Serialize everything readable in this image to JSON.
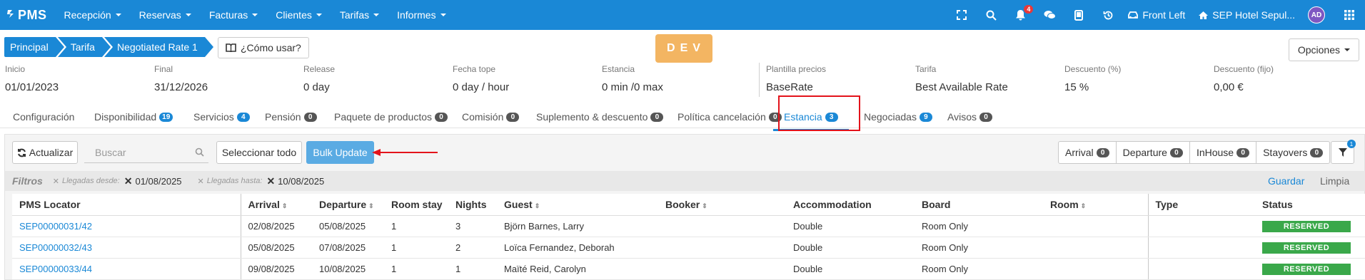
{
  "brand": {
    "name": "PMS",
    "icon": "logo-icon"
  },
  "nav": [
    {
      "label": "Recepción"
    },
    {
      "label": "Reservas"
    },
    {
      "label": "Facturas"
    },
    {
      "label": "Clientes"
    },
    {
      "label": "Tarifas"
    },
    {
      "label": "Informes"
    }
  ],
  "topbar": {
    "notifications_count": "4",
    "front_label": "Front Left",
    "hotel_label": "SEP Hotel Sepul...",
    "avatar_initials": "AD"
  },
  "breadcrumb": [
    "Principal",
    "Tarifa",
    "Negotiated Rate 1"
  ],
  "howto_label": "¿Cómo usar?",
  "env_badge": "DEV",
  "options_label": "Opciones",
  "info": [
    {
      "label": "Inicio",
      "value": "01/01/2023"
    },
    {
      "label": "Final",
      "value": "31/12/2026"
    },
    {
      "label": "Release",
      "value": "0 day"
    },
    {
      "label": "Fecha tope",
      "value": "0 day / hour"
    },
    {
      "label": "Estancia",
      "value": "0 min /0 max"
    },
    {
      "label": "Plantilla precios",
      "value": "BaseRate"
    },
    {
      "label": "Tarifa",
      "value": "Best Available Rate"
    },
    {
      "label": "Descuento (%)",
      "value": "15 %"
    },
    {
      "label": "Descuento (fijo)",
      "value": "0,00 €"
    }
  ],
  "tabs": [
    {
      "label": "Configuración",
      "badge": ""
    },
    {
      "label": "Disponibilidad",
      "badge": "19"
    },
    {
      "label": "Servicios",
      "badge": "4"
    },
    {
      "label": "Pensión",
      "badge": "0"
    },
    {
      "label": "Paquete de productos",
      "badge": "0"
    },
    {
      "label": "Comisión",
      "badge": "0"
    },
    {
      "label": "Suplemento & descuento",
      "badge": "0"
    },
    {
      "label": "Política cancelación",
      "badge": "0"
    },
    {
      "label": "Estancia",
      "badge": "3"
    },
    {
      "label": "Negociadas",
      "badge": "9"
    },
    {
      "label": "Avisos",
      "badge": "0"
    }
  ],
  "toolbar": {
    "refresh_label": "Actualizar",
    "search_placeholder": "Buscar",
    "select_all_label": "Seleccionar todo",
    "bulk_update_label": "Bulk Update",
    "segments": [
      {
        "label": "Arrival",
        "count": "0"
      },
      {
        "label": "Departure",
        "count": "0"
      },
      {
        "label": "InHouse",
        "count": "0"
      },
      {
        "label": "Stayovers",
        "count": "0"
      }
    ],
    "filter_badge": "1"
  },
  "filters": {
    "title": "Filtros",
    "from_label": "Llegadas desde:",
    "from_value": "01/08/2025",
    "to_label": "Llegadas hasta:",
    "to_value": "10/08/2025",
    "save_label": "Guardar",
    "clear_label": "Limpia"
  },
  "table": {
    "columns": [
      "PMS Locator",
      "Arrival",
      "Departure",
      "Room stay",
      "Nights",
      "Guest",
      "Booker",
      "Accommodation",
      "Board",
      "Room",
      "Type",
      "Status"
    ],
    "rows": [
      {
        "locator": "SEP00000031/42",
        "arrival": "02/08/2025",
        "departure": "05/08/2025",
        "room_stay": "1",
        "nights": "3",
        "guest": "Björn Barnes, Larry",
        "booker": "",
        "accommodation": "Double",
        "board": "Room Only",
        "room": "",
        "type": "",
        "status": "RESERVED"
      },
      {
        "locator": "SEP00000032/43",
        "arrival": "05/08/2025",
        "departure": "07/08/2025",
        "room_stay": "1",
        "nights": "2",
        "guest": "Loïca Fernandez, Deborah",
        "booker": "",
        "accommodation": "Double",
        "board": "Room Only",
        "room": "",
        "type": "",
        "status": "RESERVED"
      },
      {
        "locator": "SEP00000033/44",
        "arrival": "09/08/2025",
        "departure": "10/08/2025",
        "room_stay": "1",
        "nights": "1",
        "guest": "Maïté Reid, Carolyn",
        "booker": "",
        "accommodation": "Double",
        "board": "Room Only",
        "room": "",
        "type": "",
        "status": "RESERVED"
      }
    ]
  },
  "colors": {
    "brand_blue": "#1a88d6",
    "dev_orange": "#f3b562",
    "status_green": "#3aa84a",
    "highlight_red": "#e3131b"
  }
}
